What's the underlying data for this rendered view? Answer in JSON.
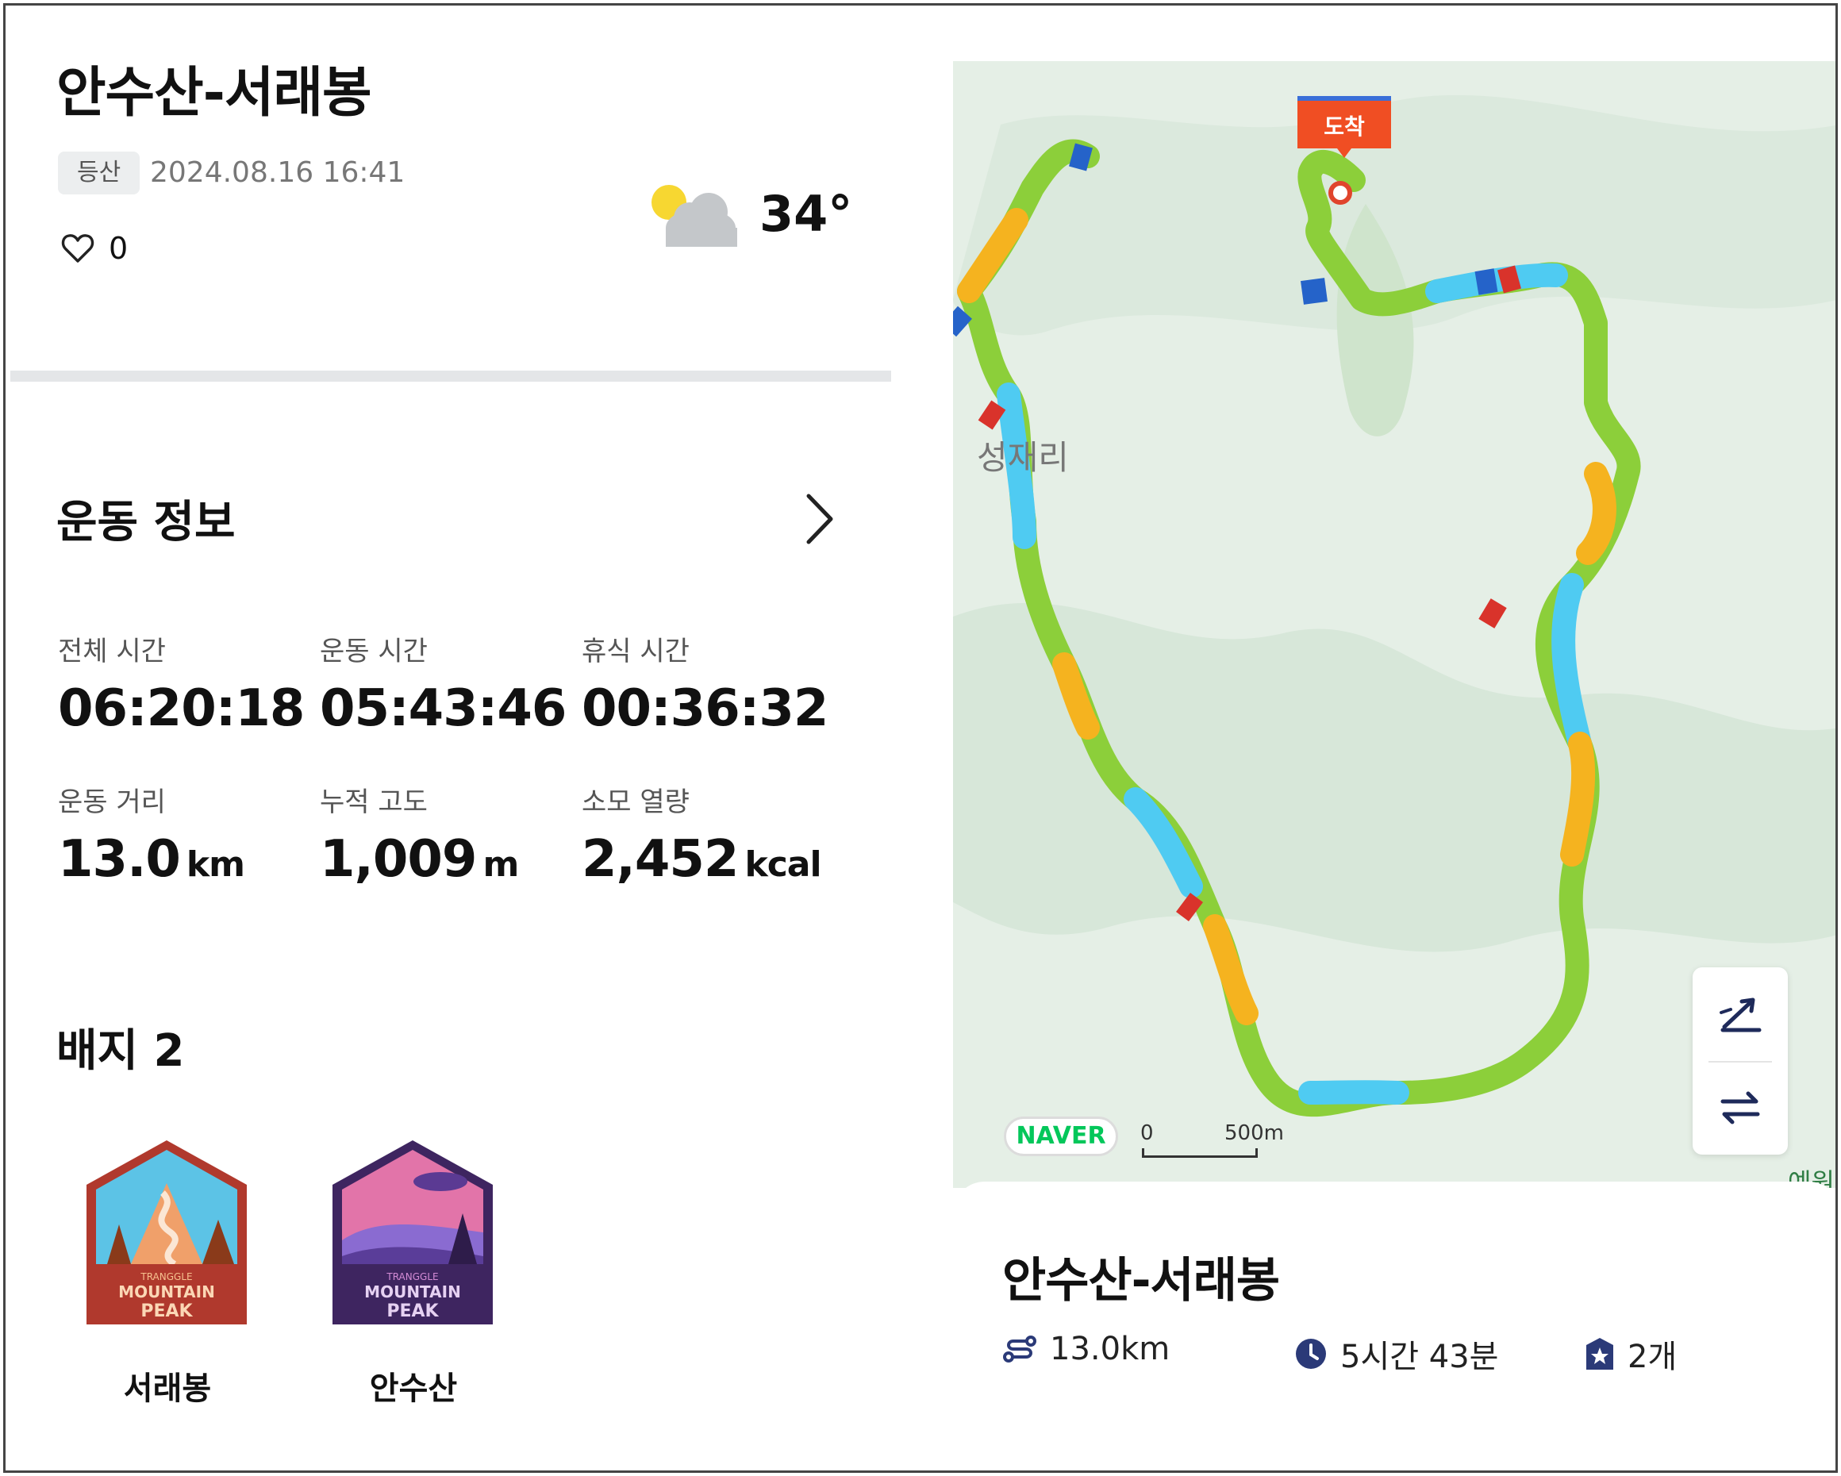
{
  "activity": {
    "title": "안수산-서래봉",
    "category": "등산",
    "datetime": "2024.08.16 16:41",
    "likes": "0"
  },
  "weather": {
    "icon": "partly-cloudy-icon",
    "temperature": "34°"
  },
  "exercise_info": {
    "section_title": "운동 정보",
    "stats": [
      {
        "label": "전체 시간",
        "value": "06:20:18",
        "unit": ""
      },
      {
        "label": "운동 시간",
        "value": "05:43:46",
        "unit": ""
      },
      {
        "label": "휴식 시간",
        "value": "00:36:32",
        "unit": ""
      },
      {
        "label": "운동 거리",
        "value": "13.0",
        "unit": "km"
      },
      {
        "label": "누적 고도",
        "value": "1,009",
        "unit": "m"
      },
      {
        "label": "소모 열량",
        "value": "2,452",
        "unit": "kcal"
      }
    ]
  },
  "badges": {
    "title": "배지 2",
    "items": [
      {
        "name": "서래봉",
        "brand": "TRANGGLE",
        "line1": "MOUNTAIN",
        "line2": "PEAK",
        "color": "#b03a2e"
      },
      {
        "name": "안수산",
        "brand": "TRANGGLE",
        "line1": "MOUNTAIN",
        "line2": "PEAK",
        "color": "#4a2a6e"
      }
    ]
  },
  "map": {
    "place_label": "성재리",
    "place_label2": "예원",
    "arrival_label": "도착",
    "provider": "NAVER",
    "scale_zero": "0",
    "scale_distance": "500m",
    "route_colors": [
      "#8ccf3a",
      "#4fcbf2",
      "#f5b31f",
      "#d9332b",
      "#2563c9"
    ]
  },
  "summary": {
    "title": "안수산-서래봉",
    "distance": "13.0km",
    "duration": "5시간 43분",
    "badges": "2개"
  }
}
